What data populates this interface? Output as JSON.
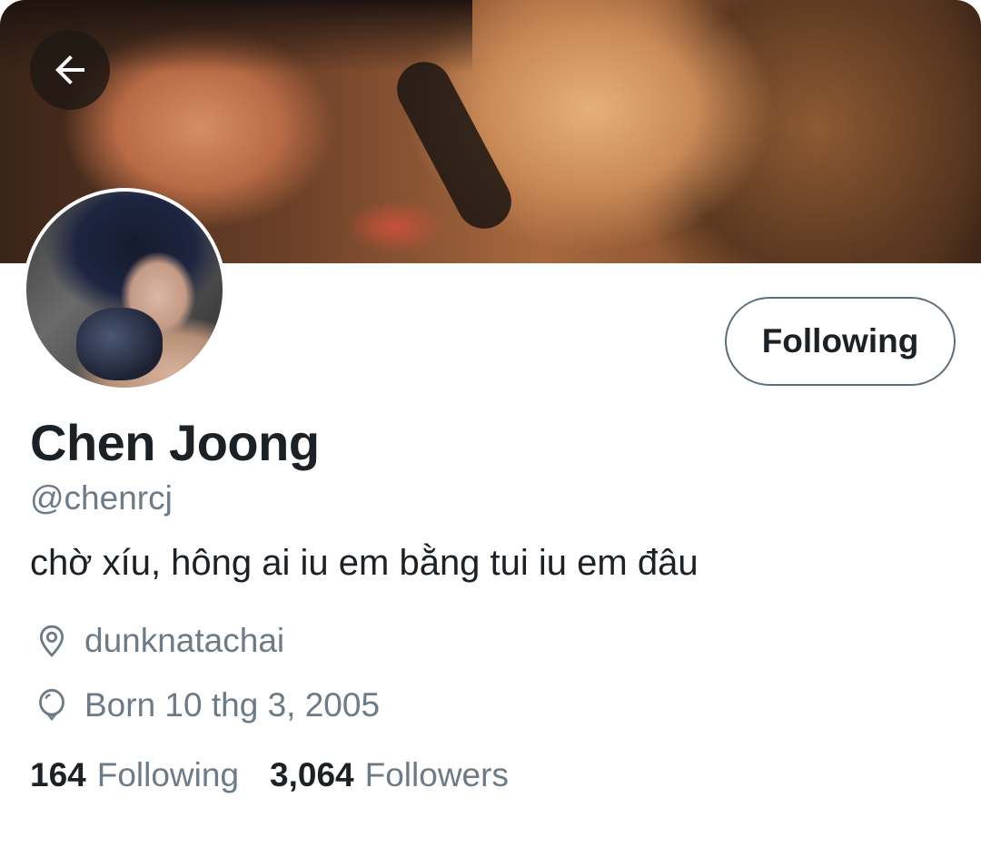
{
  "header": {
    "back_icon": "arrow-left-icon"
  },
  "profile": {
    "follow_button_label": "Following",
    "display_name": "Chen Joong",
    "handle": "@chenrcj",
    "bio": "chờ xíu, hông ai iu em bằng tui iu em đâu",
    "location": "dunknatachai",
    "location_icon": "location-pin-icon",
    "birth": "Born 10 thg 3, 2005",
    "birth_icon": "balloon-icon"
  },
  "stats": {
    "following_count": "164",
    "following_label": "Following",
    "followers_count": "3,064",
    "followers_label": "Followers"
  },
  "colors": {
    "text_primary": "#1c2126",
    "text_secondary": "#6b7b88",
    "button_border": "#5d6f7e"
  }
}
